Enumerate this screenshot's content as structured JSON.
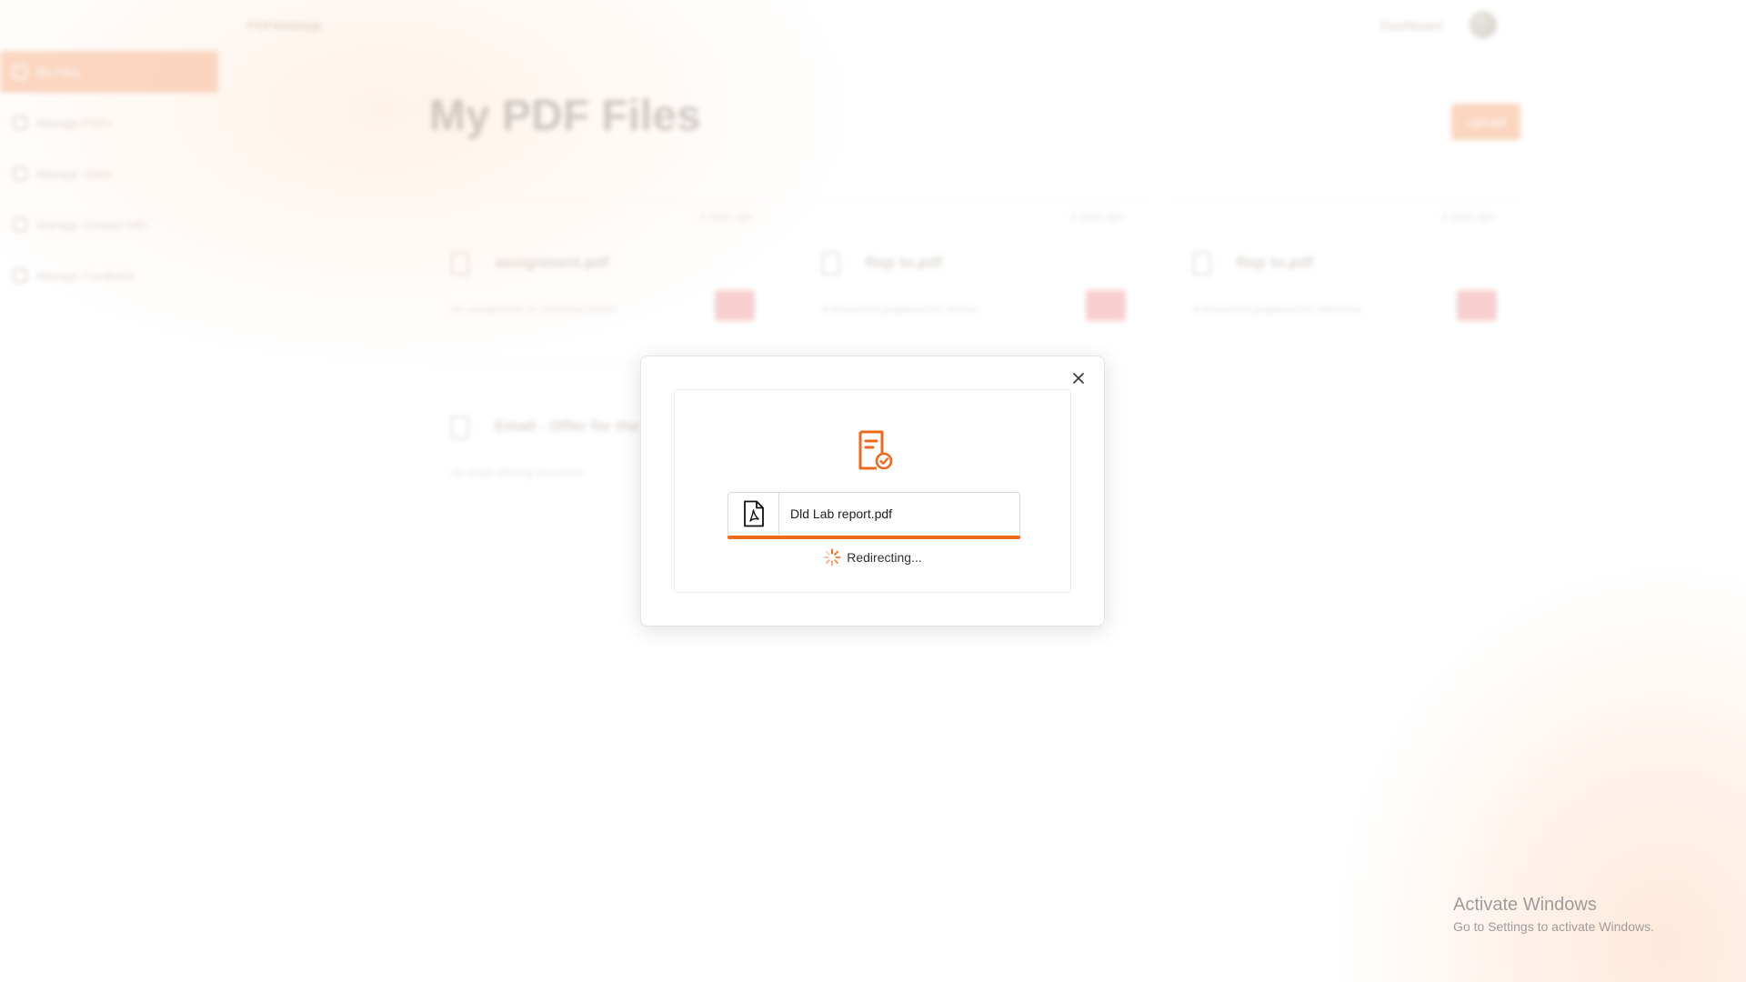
{
  "app": {
    "brand": "PDFWebApp",
    "dashboard_link": "Dashboard"
  },
  "sidebar": {
    "items": [
      {
        "label": "My Files",
        "active": true
      },
      {
        "label": "Manage PDFs",
        "active": false
      },
      {
        "label": "Manage Users",
        "active": false
      },
      {
        "label": "Manage Contact Info",
        "active": false
      },
      {
        "label": "Manage Feedback",
        "active": false
      }
    ]
  },
  "main": {
    "title": "My PDF Files",
    "upload_label": "Upload",
    "cards": [
      {
        "name": "assignment.pdf",
        "date": "2 days ago",
        "desc": "An assignment on electrical drives"
      },
      {
        "name": "Rep to.pdf",
        "date": "2 days ago",
        "desc": "A document prepared for review"
      },
      {
        "name": "Rep to.pdf",
        "date": "2 days ago",
        "desc": "A document prepared for reference"
      },
      {
        "name": "Email - Offer for the",
        "date": "",
        "desc": "An email offering document"
      }
    ]
  },
  "modal": {
    "file_name": "Dld Lab report.pdf",
    "status_text": "Redirecting...",
    "progress": 1.0,
    "icons": {
      "header": "document-check-icon",
      "file": "pdf-file-icon",
      "status": "spinner-icon",
      "close": "close-icon"
    }
  },
  "watermark": {
    "title": "Activate Windows",
    "subtitle": "Go to Settings to activate Windows."
  },
  "colors": {
    "accent": "#ee6a1f",
    "accent_light": "#f7b38b"
  }
}
